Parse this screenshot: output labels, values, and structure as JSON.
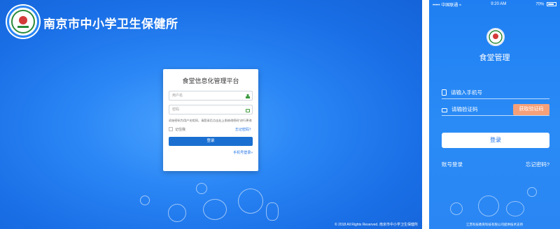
{
  "desktop": {
    "brand": "南京市中小学卫生保健所",
    "card": {
      "title": "食堂信息化管理平台",
      "username_placeholder": "用户名",
      "password_placeholder": "密码",
      "hint": "初始密码为用户名相同，请登录后点击右上角修改密码”进行更改",
      "remember": "记住我",
      "forgot": "忘记密码？",
      "login": "登录",
      "alt_login": "手机号登录»"
    },
    "footer": "© 2018 All Rights Reserved. 南京市中小学卫生保健所"
  },
  "phone": {
    "status": {
      "carrier": "中国联通",
      "time": "9:20 AM",
      "battery": "70%"
    },
    "title": "食堂管理",
    "phone_placeholder": "请输入手机号",
    "code_placeholder": "请输验证码",
    "get_code": "获取验证码",
    "login": "登录",
    "account_login": "账号登录",
    "forgot": "忘记密码?",
    "footer": "江苏科技教育科技有限公司提供技术支持"
  },
  "colors": {
    "primary": "#1a6fe6",
    "accent": "#f5a07a"
  },
  "icons": [
    "logo-icon",
    "user-icon",
    "lock-icon",
    "phone-icon",
    "signal-icon",
    "wifi-icon",
    "battery-icon"
  ]
}
